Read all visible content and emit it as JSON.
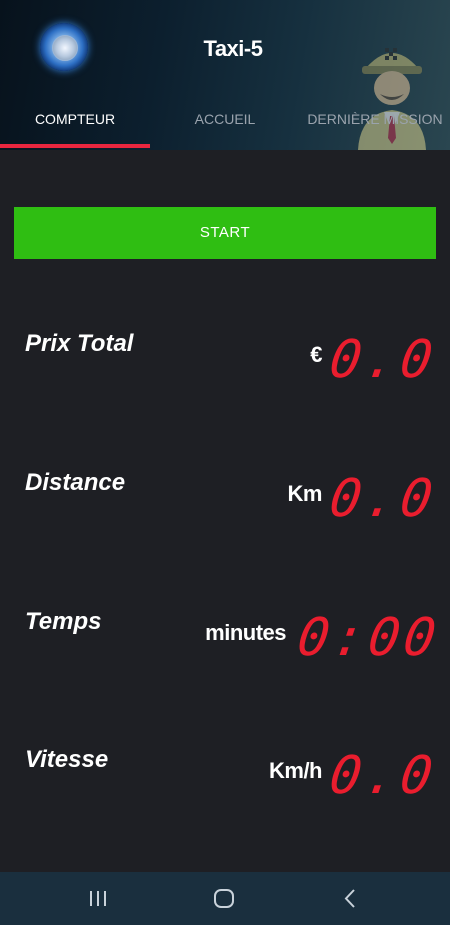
{
  "app": {
    "title": "Taxi-5"
  },
  "tabs": [
    {
      "label": "COMPTEUR",
      "active": true
    },
    {
      "label": "ACCUEIL",
      "active": false
    },
    {
      "label": "DERNIÈRE MISSION",
      "active": false
    }
  ],
  "start_button": {
    "label": "START"
  },
  "meter": {
    "price": {
      "label": "Prix Total",
      "unit": "€",
      "value": "0.0"
    },
    "distance": {
      "label": "Distance",
      "unit": "Km",
      "value": "0.0"
    },
    "time": {
      "label": "Temps",
      "unit": "minutes",
      "value": "0:00"
    },
    "speed": {
      "label": "Vitesse",
      "unit": "Km/h",
      "value": "0.0"
    }
  },
  "colors": {
    "accent": "#e8263f",
    "start_green": "#2fbe12",
    "display_red": "#ea1d2e",
    "background": "#1e1f24",
    "navbar": "#1a2f3e"
  },
  "icons": {
    "app_icon": "app-logo-icon",
    "driver": "taxi-driver-icon",
    "nav_recents": "recents-icon",
    "nav_home": "home-icon",
    "nav_back": "back-icon"
  }
}
